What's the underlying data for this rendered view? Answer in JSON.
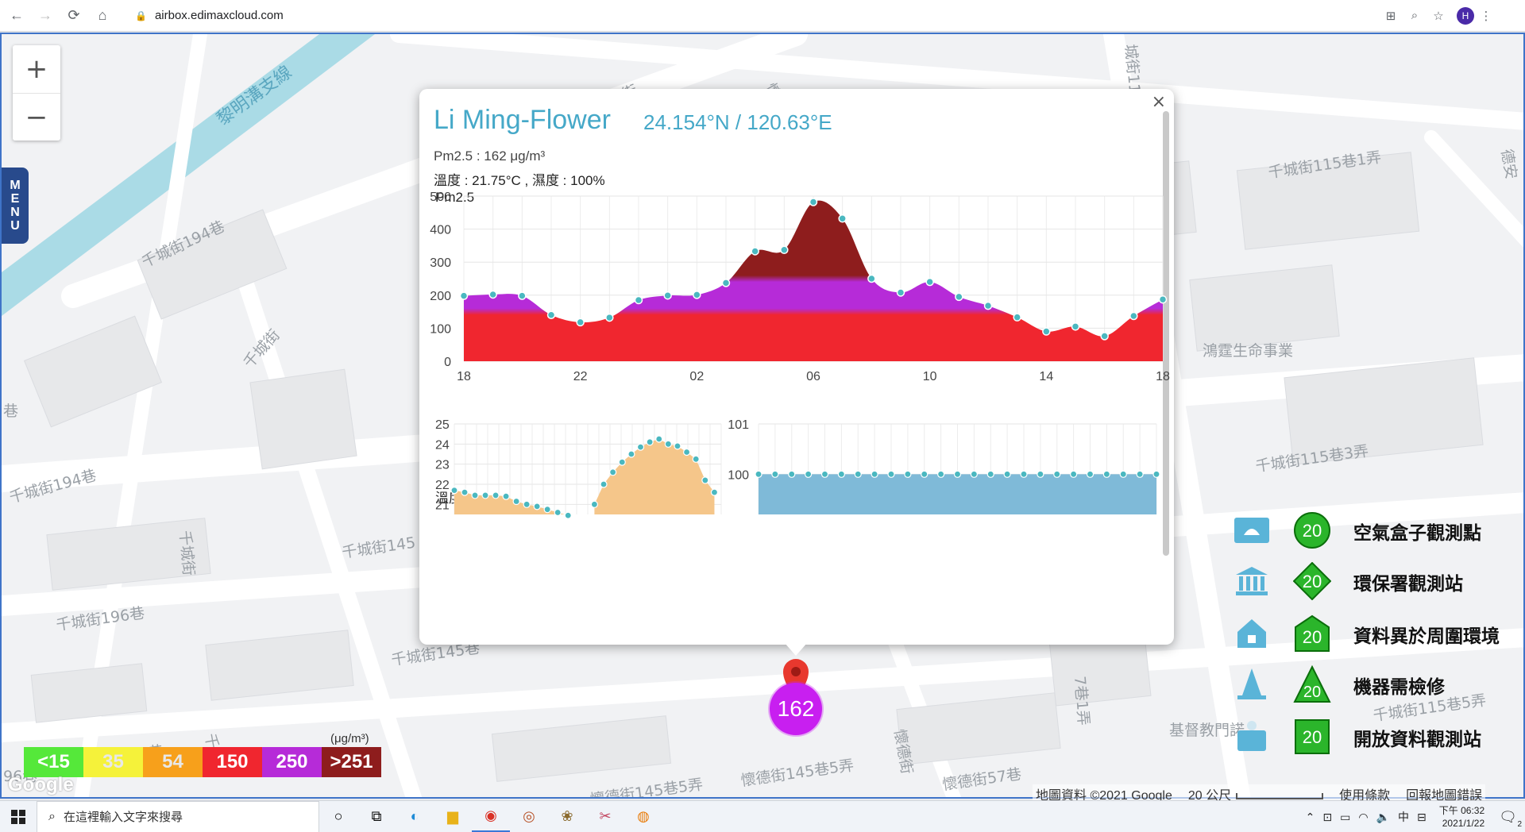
{
  "browser": {
    "url": "airbox.edimaxcloud.com",
    "profile_initial": "H"
  },
  "map": {
    "zoom_in": "+",
    "zoom_out": "−",
    "menu_label": [
      "M",
      "E",
      "N",
      "U"
    ],
    "streets": [
      "黎明溝支線",
      "千城街",
      "懷德",
      "千城街194巷",
      "千城街",
      "千城街115巷1弄",
      "德安",
      "鴻霆生命事業",
      "千城街115巷3弄",
      "千城街194巷",
      "千城街",
      "千城街145",
      "千城街196巷",
      "千城街145巷",
      "千城街196巷",
      "懷德街145巷5弄",
      "懷德街145巷5弄",
      "懷德街",
      "懷德街57巷",
      "基督教門諾",
      "千城街115巷5弄",
      "千城",
      "96巷",
      "巷",
      "城街11",
      "7巷1弄"
    ],
    "marker_value": "162",
    "google_logo": "Google",
    "attribution": {
      "data": "地圖資料 ©2021 Google",
      "scale": "20 公尺",
      "terms": "使用條款",
      "report": "回報地圖錯誤"
    }
  },
  "popup": {
    "close_label": "×",
    "station_name": "Li Ming-Flower",
    "coordinates": "24.154°N / 120.63°E",
    "pm_line": "Pm2.5 : 162 μg/m³",
    "temp_hum_line": "溫度 : 21.75°C , 濕度 : 100%",
    "pm_chart_title": "Pm2.5",
    "temp_chart_title": "溫度",
    "hum_chart_title": "濕度"
  },
  "legend": {
    "items": [
      {
        "label": "空氣盒子觀測點",
        "badge": "20",
        "shape": "circle",
        "icon": "airbox-icon"
      },
      {
        "label": "環保署觀測站",
        "badge": "20",
        "shape": "diamond",
        "icon": "government-building-icon"
      },
      {
        "label": "資料異於周圍環境",
        "badge": "20",
        "shape": "house",
        "icon": "house-icon"
      },
      {
        "label": "機器需檢修",
        "badge": "20",
        "shape": "triangle",
        "icon": "cone-icon"
      },
      {
        "label": "開放資料觀測站",
        "badge": "20",
        "shape": "square",
        "icon": "open-data-icon"
      }
    ],
    "badge_color": "#2bb52b"
  },
  "color_scale": {
    "unit": "(μg/m³)",
    "bins": [
      {
        "label": "<15",
        "color": "#55e83a"
      },
      {
        "label": "35",
        "color": "#f5f23a"
      },
      {
        "label": "54",
        "color": "#f7a01b"
      },
      {
        "label": "150",
        "color": "#f0262f"
      },
      {
        "label": "250",
        "color": "#b62bd8"
      },
      {
        "label": ">251",
        "color": "#8e1d1d"
      }
    ]
  },
  "taskbar": {
    "search_placeholder": "在這裡輸入文字來搜尋",
    "ime": "中",
    "time": "下午 06:32",
    "date": "2021/1/22",
    "notification_count": "2"
  },
  "chart_data": [
    {
      "type": "area",
      "title": "Pm2.5",
      "x_tick_labels": [
        "18",
        "22",
        "02",
        "06",
        "10",
        "14",
        "18"
      ],
      "x": [
        18,
        19,
        20,
        21,
        22,
        23,
        0,
        1,
        2,
        3,
        4,
        5,
        6,
        7,
        8,
        9,
        10,
        11,
        12,
        13,
        14,
        15,
        16,
        17,
        18
      ],
      "values": [
        198,
        202,
        198,
        140,
        118,
        132,
        185,
        199,
        201,
        237,
        333,
        337,
        482,
        432,
        250,
        208,
        240,
        195,
        168,
        133,
        90,
        105,
        76,
        137,
        187
      ],
      "ylim": [
        0,
        500
      ],
      "yticks": [
        0,
        100,
        200,
        300,
        400,
        500
      ],
      "bands": [
        {
          "from": 0,
          "to": 150,
          "color": "#f0262f"
        },
        {
          "from": 150,
          "to": 250,
          "color": "#b62bd8"
        },
        {
          "from": 250,
          "to": 500,
          "color": "#8e1d1d"
        }
      ],
      "point_color": "#4ab8c0"
    },
    {
      "type": "area",
      "title": "溫度",
      "yticks": [
        21,
        22,
        23,
        24,
        25
      ],
      "ylim": [
        20.5,
        25
      ],
      "series": [
        {
          "segment": 1,
          "values": [
            21.7,
            21.6,
            21.45,
            21.45,
            21.45,
            21.4,
            21.15,
            21.0,
            20.9,
            20.75,
            20.6,
            20.45
          ]
        },
        {
          "segment": 2,
          "values": [
            21.0,
            22.0,
            22.6,
            23.1,
            23.5,
            23.85,
            24.1,
            24.25,
            24.0,
            23.9,
            23.6,
            23.25,
            22.2,
            21.6
          ]
        }
      ],
      "fill_color": "#f5c68a"
    },
    {
      "type": "area",
      "title": "濕度",
      "yticks": [
        100,
        101
      ],
      "ylim": [
        99.2,
        101
      ],
      "values": [
        100,
        100,
        100,
        100,
        100,
        100,
        100,
        100,
        100,
        100,
        100,
        100,
        100,
        100,
        100,
        100,
        100,
        100,
        100,
        100,
        100,
        100,
        100,
        100,
        100
      ],
      "fill_color": "#7fbad8"
    }
  ]
}
